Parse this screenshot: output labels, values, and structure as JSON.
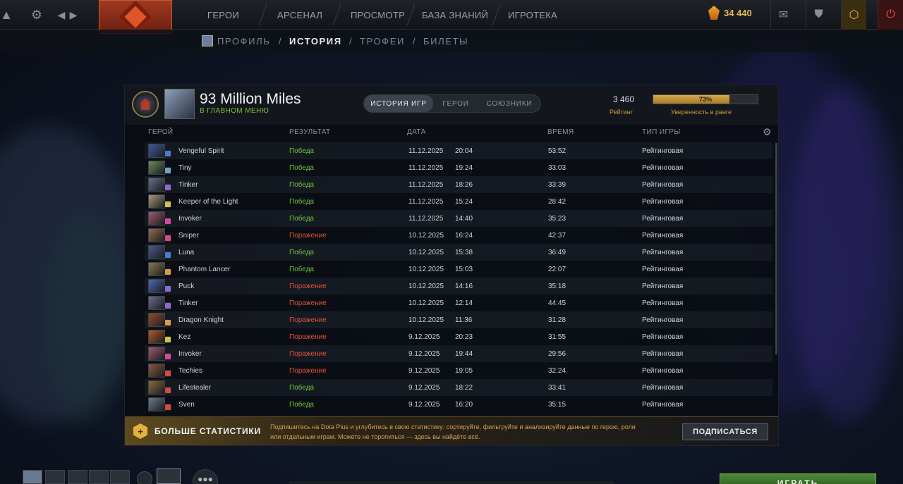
{
  "topbar": {
    "nav": [
      "ГЕРОИ",
      "АРСЕНАЛ",
      "ПРОСМОТР",
      "БАЗА ЗНАНИЙ",
      "ИГРОТЕКА"
    ],
    "currency": "34 440"
  },
  "subnav": {
    "items": [
      "ПРОФИЛЬ",
      "ИСТОРИЯ",
      "ТРОФЕИ",
      "БИЛЕТЫ"
    ],
    "separator": "/",
    "active": "ИСТОРИЯ"
  },
  "profile": {
    "name": "93 Million Miles",
    "status": "В ГЛАВНОМ МЕНЮ",
    "rating_value": "3 460",
    "rating_label": "Рейтинг",
    "confidence_percent": 73,
    "confidence_text": "73%",
    "confidence_label": "Уверенность в ранге"
  },
  "tabs": {
    "items": [
      "ИСТОРИЯ ИГР",
      "ГЕРОИ",
      "СОЮЗНИКИ"
    ],
    "active": "ИСТОРИЯ ИГР"
  },
  "table": {
    "columns": [
      "ГЕРОЙ",
      "РЕЗУЛЬТАТ",
      "ДАТА",
      "ВРЕМЯ",
      "ТИП ИГРЫ"
    ],
    "rows": [
      {
        "hero": "Vengeful Spirit",
        "result": "Победа",
        "date": "11.12.2025",
        "time": "20:04",
        "duration": "53:52",
        "type": "Рейтинговая",
        "win": true,
        "color": "#3f5a9e",
        "badge": "#4a7bd1"
      },
      {
        "hero": "Tiny",
        "result": "Победа",
        "date": "11.12.2025",
        "time": "19:24",
        "duration": "33:03",
        "type": "Рейтинговая",
        "win": true,
        "color": "#6d8a55",
        "badge": "#7aa0c8"
      },
      {
        "hero": "Tinker",
        "result": "Победа",
        "date": "11.12.2025",
        "time": "18:26",
        "duration": "33:39",
        "type": "Рейтинговая",
        "win": true,
        "color": "#6a6d8a",
        "badge": "#8b6bd1"
      },
      {
        "hero": "Keeper of the Light",
        "result": "Победа",
        "date": "11.12.2025",
        "time": "15:24",
        "duration": "28:42",
        "type": "Рейтинговая",
        "win": true,
        "color": "#a89a7a",
        "badge": "#d1c24a"
      },
      {
        "hero": "Invoker",
        "result": "Победа",
        "date": "11.12.2025",
        "time": "14:40",
        "duration": "35:23",
        "type": "Рейтинговая",
        "win": true,
        "color": "#a05a6a",
        "badge": "#d14aa0"
      },
      {
        "hero": "Sniper",
        "result": "Поражение",
        "date": "10.12.2025",
        "time": "16:24",
        "duration": "42:37",
        "type": "Рейтинговая",
        "win": false,
        "color": "#9a6a4a",
        "badge": "#d14a8a"
      },
      {
        "hero": "Luna",
        "result": "Победа",
        "date": "10.12.2025",
        "time": "15:38",
        "duration": "36:49",
        "type": "Рейтинговая",
        "win": true,
        "color": "#4a5a8a",
        "badge": "#4a7bd1"
      },
      {
        "hero": "Phantom Lancer",
        "result": "Победа",
        "date": "10.12.2025",
        "time": "15:03",
        "duration": "22:07",
        "type": "Рейтинговая",
        "win": true,
        "color": "#8a7a4a",
        "badge": "#d1a04a"
      },
      {
        "hero": "Puck",
        "result": "Поражение",
        "date": "10.12.2025",
        "time": "14:16",
        "duration": "35:18",
        "type": "Рейтинговая",
        "win": false,
        "color": "#4a6ab0",
        "badge": "#8b6bd1"
      },
      {
        "hero": "Tinker",
        "result": "Поражение",
        "date": "10.12.2025",
        "time": "12:14",
        "duration": "44:45",
        "type": "Рейтинговая",
        "win": false,
        "color": "#6a6d8a",
        "badge": "#8b6bd1"
      },
      {
        "hero": "Dragon Knight",
        "result": "Поражение",
        "date": "10.12.2025",
        "time": "11:36",
        "duration": "31:28",
        "type": "Рейтинговая",
        "win": false,
        "color": "#9a4a2a",
        "badge": "#d1a04a"
      },
      {
        "hero": "Kez",
        "result": "Поражение",
        "date": "9.12.2025",
        "time": "20:23",
        "duration": "31:55",
        "type": "Рейтинговая",
        "win": false,
        "color": "#b0582a",
        "badge": "#d1c24a"
      },
      {
        "hero": "Invoker",
        "result": "Поражение",
        "date": "9.12.2025",
        "time": "19:44",
        "duration": "29:56",
        "type": "Рейтинговая",
        "win": false,
        "color": "#a05a6a",
        "badge": "#d14aa0"
      },
      {
        "hero": "Techies",
        "result": "Поражение",
        "date": "9.12.2025",
        "time": "19:05",
        "duration": "32:24",
        "type": "Рейтинговая",
        "win": false,
        "color": "#8a5a3a",
        "badge": "#d14a4a"
      },
      {
        "hero": "Lifestealer",
        "result": "Победа",
        "date": "9.12.2025",
        "time": "18:22",
        "duration": "33:41",
        "type": "Рейтинговая",
        "win": true,
        "color": "#8a6a3a",
        "badge": "#d14a4a"
      },
      {
        "hero": "Sven",
        "result": "Победа",
        "date": "9.12.2025",
        "time": "16:20",
        "duration": "35:15",
        "type": "Рейтинговая",
        "win": true,
        "color": "#6a7a8a",
        "badge": "#d14a4a"
      }
    ]
  },
  "promo": {
    "title": "БОЛЬШЕ СТАТИСТИКИ",
    "text": "Подпишитесь на Dota Plus и углубитесь в свою статистику: сортируйте, фильтруйте и анализируйте данные по герою, роли или отдельным играм. Можете не торопиться — здесь вы найдёте всё.",
    "button": "ПОДПИСАТЬСЯ"
  },
  "bottom": {
    "play_label": "ИГРАТЬ"
  },
  "colors": {
    "win": "#6fc23a",
    "loss": "#e0503a",
    "accent_gold": "#c99b3a"
  },
  "icons": [
    "gear-icon",
    "arrow-left-icon",
    "arrow-right-icon",
    "dota-logo-icon",
    "shards-icon",
    "mail-icon",
    "armory-icon",
    "dota-plus-icon",
    "power-icon",
    "table-settings-gear-icon",
    "dota-plus-promo-icon",
    "party-icon"
  ]
}
